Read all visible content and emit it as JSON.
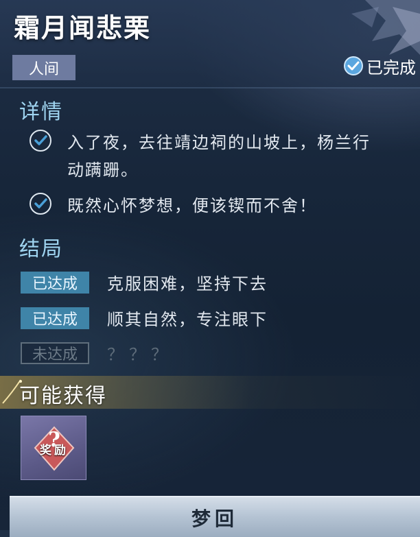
{
  "header": {
    "title": "霜月闻悲栗",
    "realm_tag": "人间",
    "status": "已完成"
  },
  "details": {
    "title": "详情",
    "items": [
      {
        "text_line1": "入了夜，去往靖边祠的山坡上，杨兰行",
        "text_line2": "动蹒跚。",
        "checked": true
      },
      {
        "text_line1": "既然心怀梦想，便该锲而不舍！",
        "checked": true
      }
    ]
  },
  "endings": {
    "title": "结局",
    "items": [
      {
        "status": "已达成",
        "text": "克服困难，坚持下去",
        "achieved": true
      },
      {
        "status": "已达成",
        "text": "顺其自然，专注眼下",
        "achieved": true
      },
      {
        "status": "未达成",
        "text": "？？？",
        "achieved": false
      }
    ]
  },
  "rewards": {
    "title": "可能获得",
    "items": [
      {
        "label": "奖励",
        "icon": "question-mark-icon"
      }
    ]
  },
  "footer": {
    "button_label": "梦回"
  },
  "colors": {
    "accent": "#9fd4f0",
    "badge_done": "#3f84a8",
    "check": "#4aa0d8"
  }
}
